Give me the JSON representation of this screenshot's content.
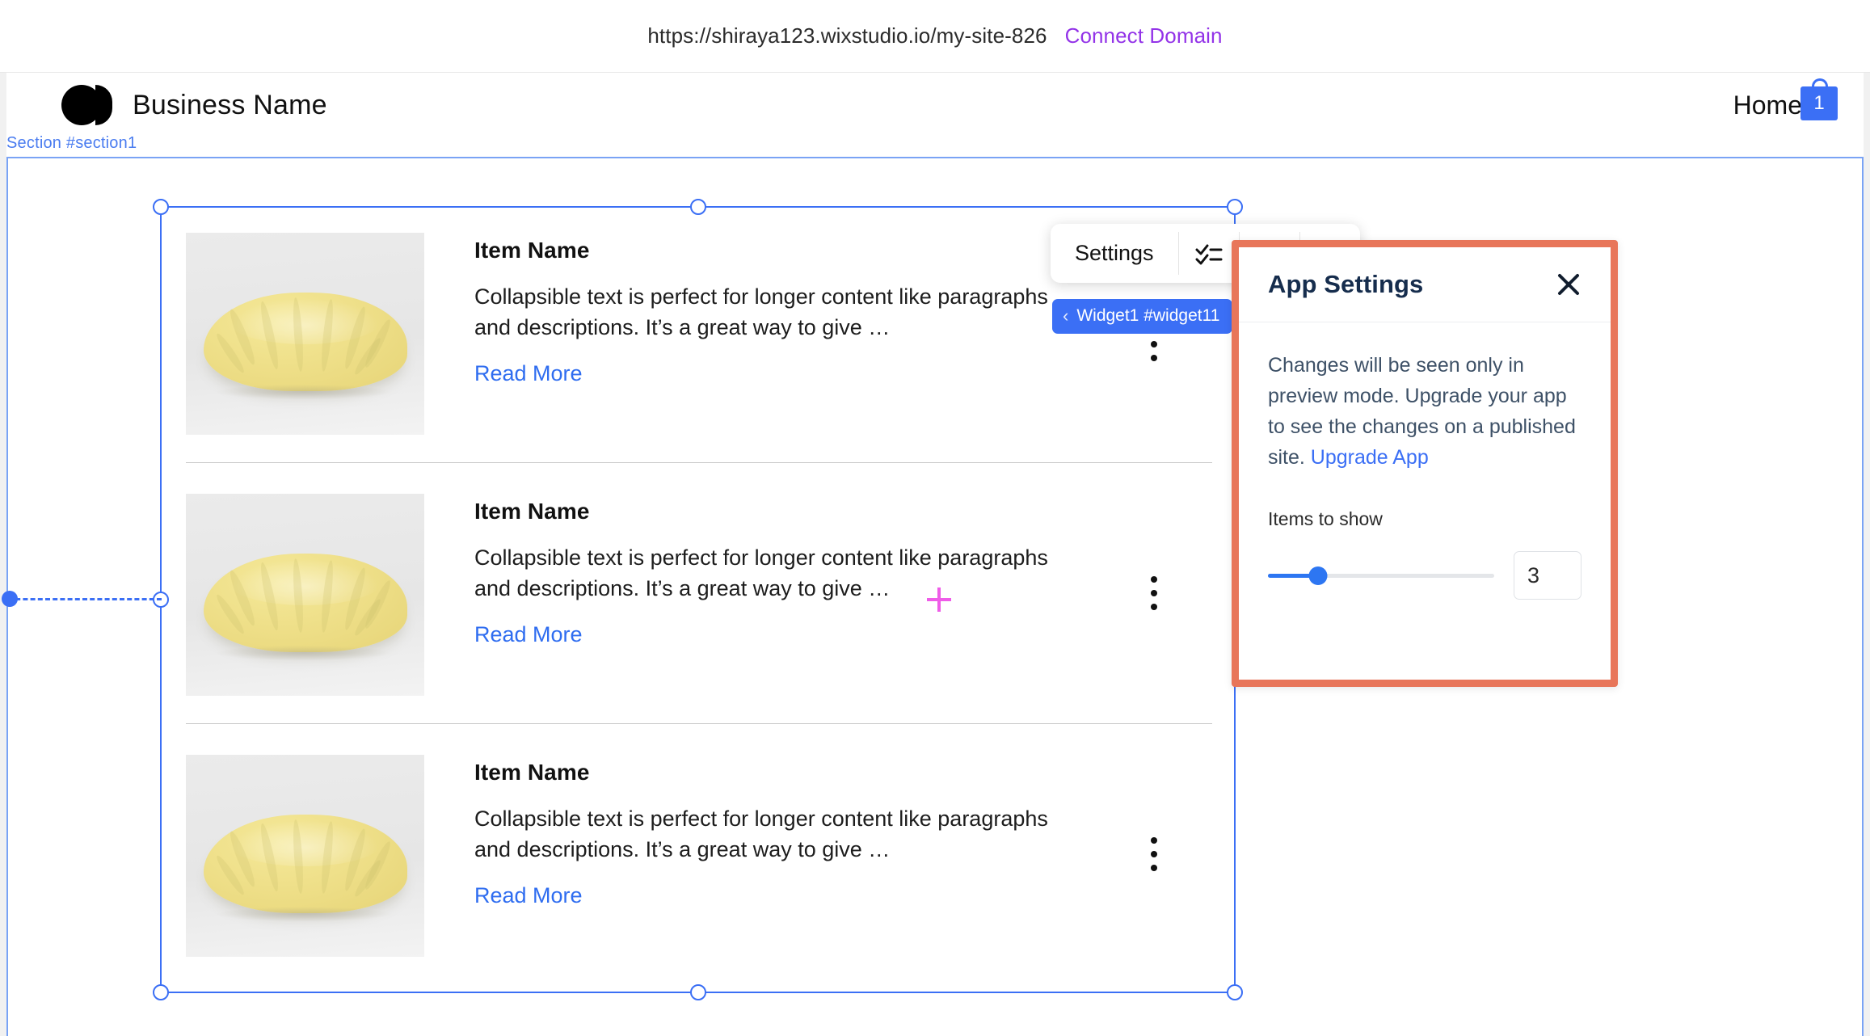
{
  "urlbar": {
    "url": "https://shiraya123.wixstudio.io/my-site-826",
    "connect_label": "Connect Domain",
    "connect_color": "#9333e8"
  },
  "site_header": {
    "logo_icon": "circle-halfcircle-logo-icon",
    "brand_name": "Business Name",
    "nav": [
      {
        "label": "Home"
      }
    ],
    "cart": {
      "icon": "shopping-bag-icon",
      "count": "1",
      "color": "#3b6ff5"
    }
  },
  "canvas": {
    "section_label": "Section #section1",
    "section_label_color": "#4a7cf0",
    "selection_color": "#3b6ff5"
  },
  "widget_badge": {
    "chevron": "‹",
    "label": "Widget1 #widget11"
  },
  "editor_toolbar": {
    "settings_label": "Settings",
    "checklist_icon": "checklist-icon",
    "layout_icon": "layout-icon",
    "person_icon": "person-icon"
  },
  "items": [
    {
      "title": "Item Name",
      "description": "Collapsible text is perfect for longer content like paragraphs and descriptions. It’s a great way to give …",
      "link": "Read More",
      "image_alt": "yellow-puffy-cushion",
      "menu_icon": "kebab-menu-icon"
    },
    {
      "title": "Item Name",
      "description": "Collapsible text is perfect for longer content like paragraphs and descriptions. It’s a great way to give …",
      "link": "Read More",
      "image_alt": "yellow-puffy-cushion",
      "menu_icon": "kebab-menu-icon"
    },
    {
      "title": "Item Name",
      "description": "Collapsible text is perfect for longer content like paragraphs and descriptions. It’s a great way to give …",
      "link": "Read More",
      "image_alt": "yellow-puffy-cushion",
      "menu_icon": "kebab-menu-icon"
    }
  ],
  "settings_panel": {
    "title": "App Settings",
    "close_icon": "close-icon",
    "note_text": "Changes will be seen only in preview mode. Upgrade your app to see the changes on a published site. ",
    "note_link": "Upgrade App",
    "field_label": "Items to show",
    "slider_value": "3",
    "slider_percent": 22,
    "border_color": "#e8765a",
    "accent_color": "#2d76f2"
  },
  "cursor": {
    "type": "crosshair-cursor",
    "color": "#ef5ce8"
  }
}
